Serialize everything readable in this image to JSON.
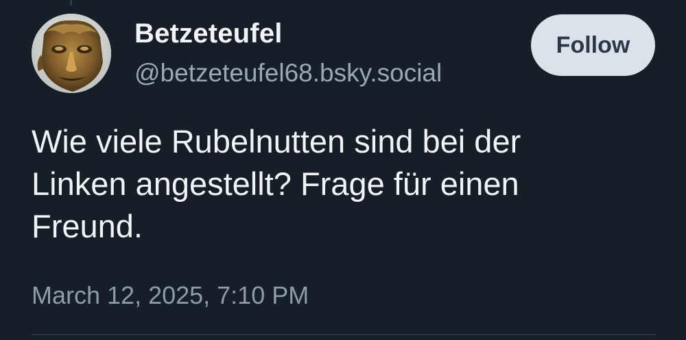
{
  "author": {
    "display_name": "Betzeteufel",
    "handle": "@betzeteufel68.bsky.social",
    "avatar_icon": "bronze-face-statue-avatar"
  },
  "follow_button": {
    "label": "Follow"
  },
  "post": {
    "text_lines": [
      "Wie viele Rubelnutten sind bei der",
      "Linken angestellt? Frage für einen",
      "Freund."
    ],
    "timestamp": "March 12, 2025, 7:10 PM"
  },
  "colors": {
    "background": "#161e27",
    "text_primary": "#f1f3f5",
    "text_secondary": "#9aa8b8",
    "button_bg": "#dce2ea",
    "button_text": "#2b3848"
  }
}
